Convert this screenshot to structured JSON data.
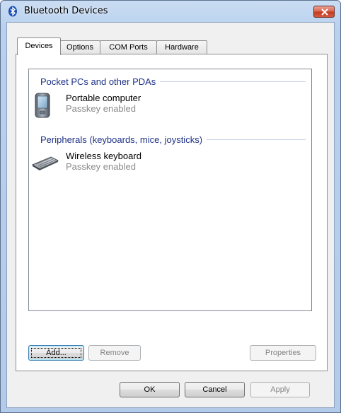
{
  "window": {
    "title": "Bluetooth Devices"
  },
  "tabs": [
    {
      "label": "Devices",
      "active": true
    },
    {
      "label": "Options",
      "active": false
    },
    {
      "label": "COM Ports",
      "active": false
    },
    {
      "label": "Hardware",
      "active": false
    }
  ],
  "groups": [
    {
      "header": "Pocket PCs and other PDAs",
      "items": [
        {
          "name": "Portable computer",
          "status": "Passkey enabled",
          "icon": "pda-icon"
        }
      ]
    },
    {
      "header": "Peripherals (keyboards, mice, joysticks)",
      "items": [
        {
          "name": "Wireless keyboard",
          "status": "Passkey enabled",
          "icon": "keyboard-icon"
        }
      ]
    }
  ],
  "panel_buttons": {
    "add": "Add...",
    "remove": "Remove",
    "properties": "Properties"
  },
  "dialog_buttons": {
    "ok": "OK",
    "cancel": "Cancel",
    "apply": "Apply"
  }
}
